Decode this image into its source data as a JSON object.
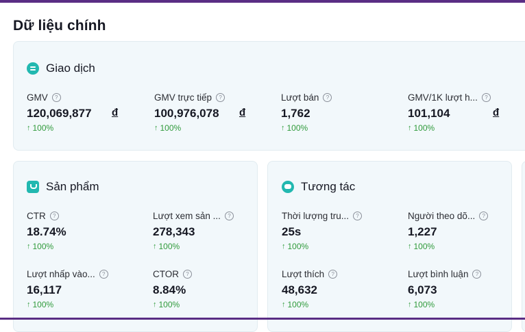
{
  "section_title": "Dữ liệu chính",
  "colors": {
    "accent": "#22b8b0",
    "positive": "#2f9a3b",
    "frame": "#5a2d84",
    "card_bg": "#f2f8fb"
  },
  "transactions": {
    "title": "Giao dịch",
    "icon": "transaction-icon",
    "metrics": [
      {
        "label": "GMV",
        "value": "120,069,877",
        "unit": "đ",
        "change": "100%"
      },
      {
        "label": "GMV trực tiếp",
        "value": "100,976,078",
        "unit": "đ",
        "change": "100%"
      },
      {
        "label": "Lượt bán",
        "value": "1,762",
        "unit": "",
        "change": "100%"
      },
      {
        "label": "GMV/1K lượt h...",
        "value": "101,104",
        "unit": "đ",
        "change": "100%"
      }
    ]
  },
  "products": {
    "title": "Sản phẩm",
    "icon": "shopping-bag-icon",
    "metrics": [
      {
        "label": "CTR",
        "value": "18.74%",
        "change": "100%"
      },
      {
        "label": "Lượt xem sản ...",
        "value": "278,343",
        "change": "100%"
      },
      {
        "label": "Lượt nhấp vào...",
        "value": "16,117",
        "change": "100%"
      },
      {
        "label": "CTOR",
        "value": "8.84%",
        "change": "100%"
      }
    ]
  },
  "engagement": {
    "title": "Tương tác",
    "icon": "chat-icon",
    "metrics": [
      {
        "label": "Thời lượng tru...",
        "value": "25s",
        "change": "100%"
      },
      {
        "label": "Người theo dõ...",
        "value": "1,227",
        "change": "100%"
      },
      {
        "label": "Lượt thích",
        "value": "48,632",
        "change": "100%"
      },
      {
        "label": "Lượt bình luận",
        "value": "6,073",
        "change": "100%"
      }
    ]
  }
}
